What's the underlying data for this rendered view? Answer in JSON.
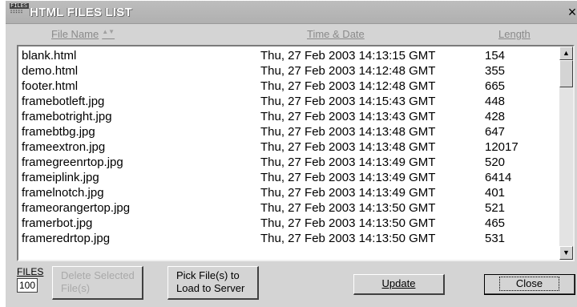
{
  "window": {
    "icon_label_top": "FILES",
    "icon_label_bottom": ":::::",
    "title": "HTML FILES LIST",
    "close_glyph": "×"
  },
  "columns": {
    "name": "File Name",
    "sort_indicator": "▲▼",
    "date": "Time & Date",
    "length": "Length"
  },
  "files": [
    {
      "name": "blank.html",
      "date": "Thu, 27 Feb 2003 14:13:15 GMT",
      "length": "154"
    },
    {
      "name": "demo.html",
      "date": "Thu, 27 Feb 2003 14:12:48 GMT",
      "length": "355"
    },
    {
      "name": "footer.html",
      "date": "Thu, 27 Feb 2003 14:12:48 GMT",
      "length": "665"
    },
    {
      "name": "framebotleft.jpg",
      "date": "Thu, 27 Feb 2003 14:15:43 GMT",
      "length": "448"
    },
    {
      "name": "framebotright.jpg",
      "date": "Thu, 27 Feb 2003 14:13:43 GMT",
      "length": "428"
    },
    {
      "name": "framebtbg.jpg",
      "date": "Thu, 27 Feb 2003 14:13:48 GMT",
      "length": "647"
    },
    {
      "name": "frameextron.jpg",
      "date": "Thu, 27 Feb 2003 14:13:48 GMT",
      "length": "12017"
    },
    {
      "name": "framegreenrtop.jpg",
      "date": "Thu, 27 Feb 2003 14:13:49 GMT",
      "length": "520"
    },
    {
      "name": "frameiplink.jpg",
      "date": "Thu, 27 Feb 2003 14:13:49 GMT",
      "length": "6414"
    },
    {
      "name": "framelnotch.jpg",
      "date": "Thu, 27 Feb 2003 14:13:49 GMT",
      "length": "401"
    },
    {
      "name": "frameorangertop.jpg",
      "date": "Thu, 27 Feb 2003 14:13:50 GMT",
      "length": "521"
    },
    {
      "name": "framerbot.jpg",
      "date": "Thu, 27 Feb 2003 14:13:50 GMT",
      "length": "465"
    },
    {
      "name": "frameredrtop.jpg",
      "date": "Thu, 27 Feb 2003 14:13:50 GMT",
      "length": "531"
    }
  ],
  "scrollbar": {
    "up_glyph": "▲",
    "down_glyph": "▼"
  },
  "footer": {
    "files_label": "FILES",
    "files_count": "100",
    "delete_label": "Delete Selected File(s)",
    "pick_label": "Pick File(s) to Load to Server",
    "update_label": "Update",
    "close_label": "Close"
  }
}
